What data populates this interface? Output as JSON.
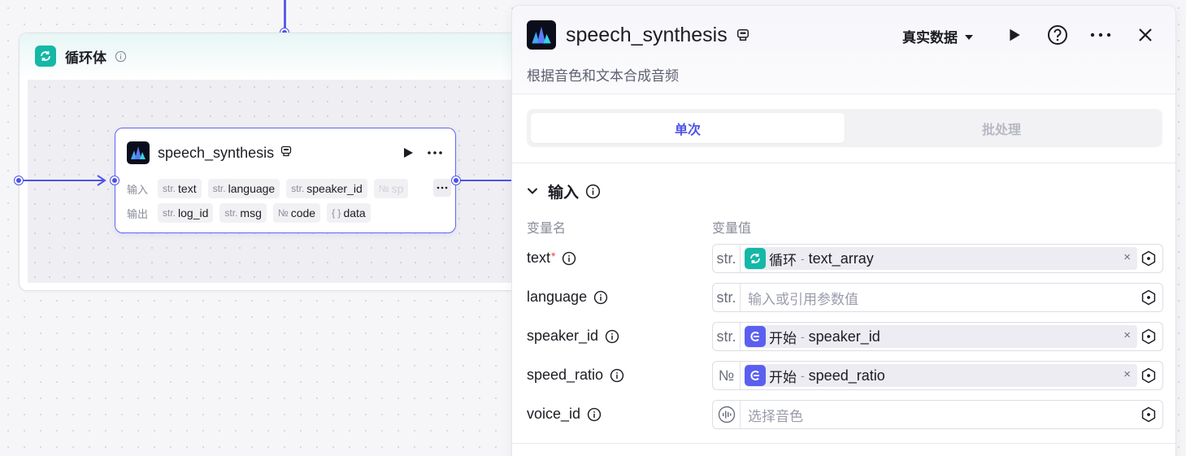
{
  "canvas": {
    "loop": {
      "title": "循环体",
      "icon": "loop-icon"
    },
    "node": {
      "title": "speech_synthesis",
      "input_label": "输入",
      "output_label": "输出",
      "inputs": [
        {
          "type": "str.",
          "name": "text"
        },
        {
          "type": "str.",
          "name": "language"
        },
        {
          "type": "str.",
          "name": "speaker_id"
        },
        {
          "type": "№",
          "name": "sp"
        }
      ],
      "outputs": [
        {
          "type": "str.",
          "name": "log_id"
        },
        {
          "type": "str.",
          "name": "msg"
        },
        {
          "type": "№",
          "name": "code"
        },
        {
          "type": "{ }",
          "name": "data"
        }
      ]
    }
  },
  "panel": {
    "title": "speech_synthesis",
    "description": "根据音色和文本合成音频",
    "data_mode": "真实数据",
    "tabs": [
      {
        "label": "单次",
        "active": true
      },
      {
        "label": "批处理",
        "active": false
      }
    ],
    "section_title": "输入",
    "col_name": "变量名",
    "col_value": "变量值",
    "params": [
      {
        "name": "text",
        "required": true,
        "type": "str.",
        "ref_source": "循环",
        "ref_var": "text_array",
        "ref_kind": "loop"
      },
      {
        "name": "language",
        "required": false,
        "type": "str.",
        "placeholder": "输入或引用参数值"
      },
      {
        "name": "speaker_id",
        "required": false,
        "type": "str.",
        "ref_source": "开始",
        "ref_var": "speaker_id",
        "ref_kind": "start"
      },
      {
        "name": "speed_ratio",
        "required": false,
        "type": "№",
        "ref_source": "开始",
        "ref_var": "speed_ratio",
        "ref_kind": "start"
      },
      {
        "name": "voice_id",
        "required": false,
        "type": "voice",
        "placeholder": "选择音色"
      }
    ],
    "required_mark": "*",
    "clear_mark": "×",
    "ref_separator": "-"
  },
  "colors": {
    "accent": "#4d53e8",
    "loop_teal": "#14b8a6",
    "start_indigo": "#5b5ff0",
    "required_red": "#e5484d"
  }
}
